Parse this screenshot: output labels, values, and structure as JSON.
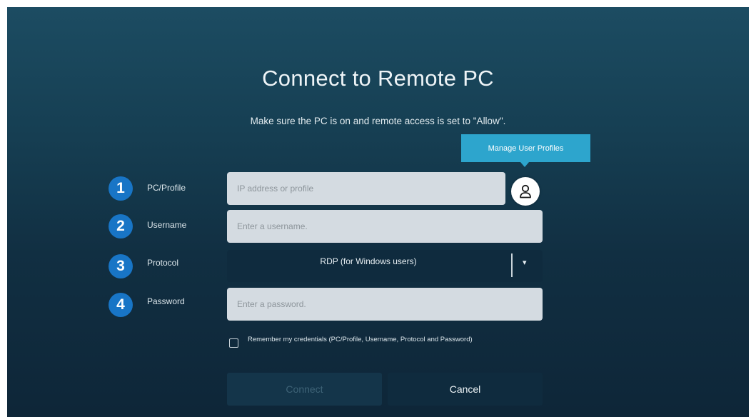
{
  "dialog": {
    "title": "Connect to Remote PC",
    "subtitle": "Make sure the PC is on and remote access is set to \"Allow\"."
  },
  "tooltip": {
    "text": "Manage User Profiles"
  },
  "fields": {
    "pc_profile": {
      "number": "1",
      "label": "PC/Profile",
      "placeholder": "IP address or profile",
      "value": ""
    },
    "username": {
      "number": "2",
      "label": "Username",
      "placeholder": "Enter a username.",
      "value": ""
    },
    "protocol": {
      "number": "3",
      "label": "Protocol",
      "value": "RDP (for Windows users)"
    },
    "password": {
      "number": "4",
      "label": "Password",
      "placeholder": "Enter a password.",
      "value": ""
    }
  },
  "remember": {
    "label": "Remember my credentials (PC/Profile, Username, Protocol and Password)",
    "checked": false
  },
  "buttons": {
    "connect": "Connect",
    "cancel": "Cancel"
  },
  "icons": {
    "profile": "user-profile-icon",
    "dropdown": "chevron-down-icon"
  },
  "colors": {
    "accent": "#1875c6",
    "tooltip": "#2da5cd"
  }
}
